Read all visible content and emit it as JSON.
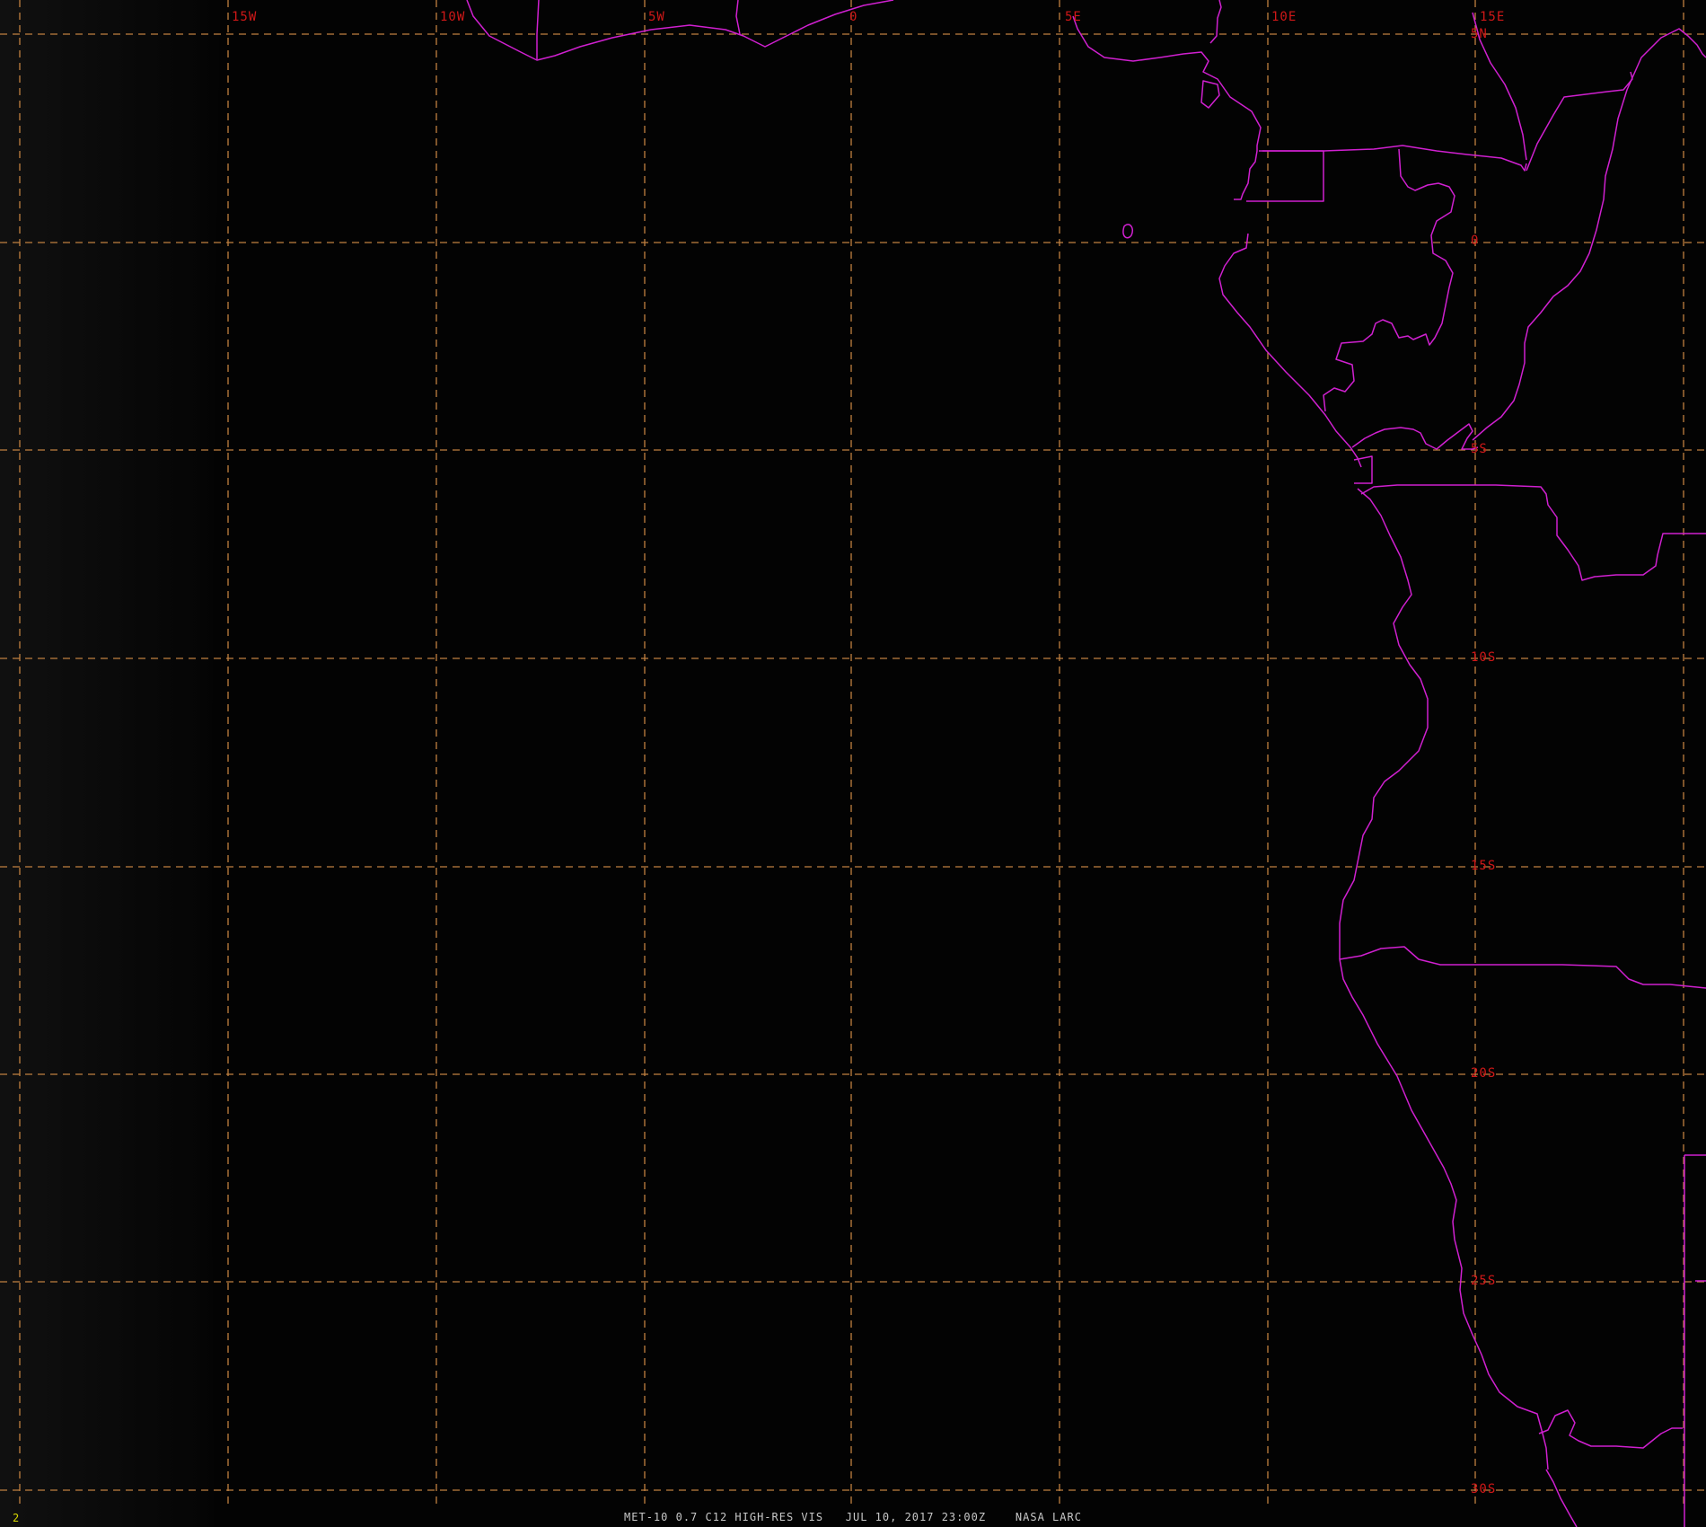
{
  "image": {
    "frame_number": "2",
    "caption": "MET-10 0.7 C12 HIGH-RES VIS   JUL 10, 2017 23:00Z    NASA LARC",
    "background_color": "#000000",
    "grid_color": "#c08040",
    "label_color": "#d01818",
    "coastline_color": "#d020d0"
  },
  "longitude_labels": [
    "15W",
    "10W",
    "5W",
    "0",
    "5E",
    "10E",
    "15E"
  ],
  "latitude_labels": [
    "5N",
    "0",
    "5S",
    "10S",
    "15S",
    "20S",
    "25S",
    "30S"
  ]
}
